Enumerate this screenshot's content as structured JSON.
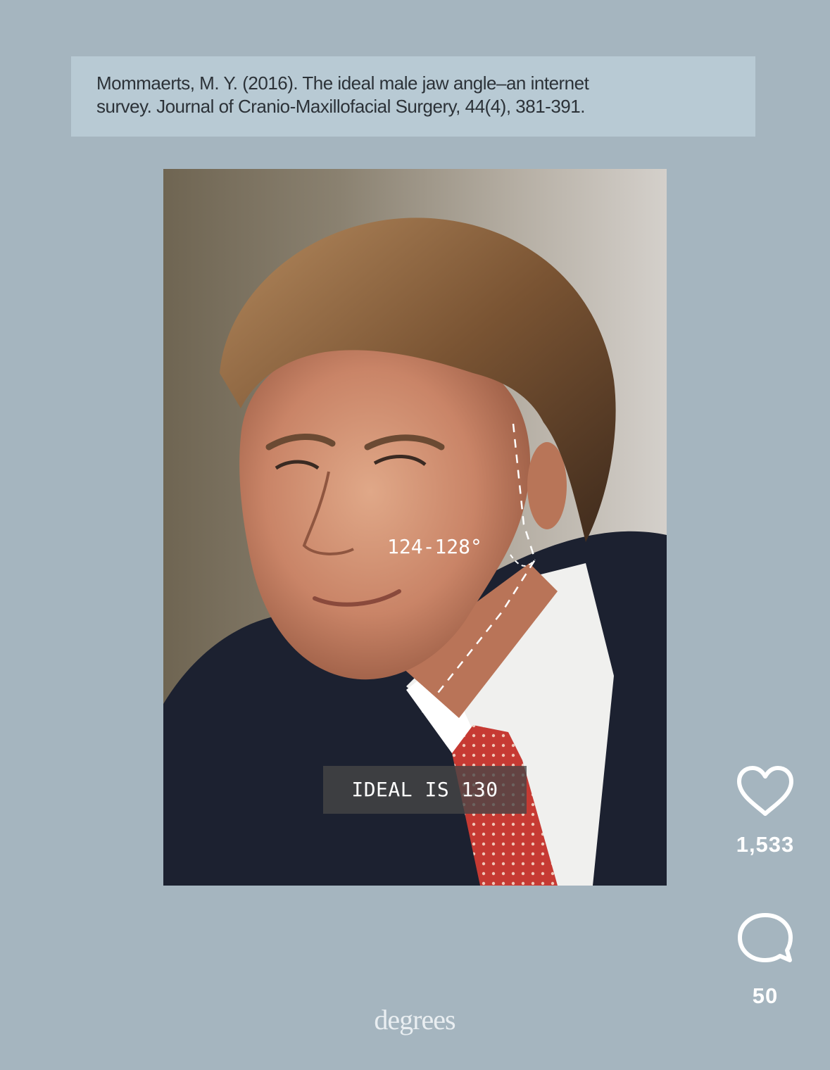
{
  "citation": {
    "line1": "Mommaerts, M. Y. (2016). The ideal male jaw angle–an internet",
    "line2": "survey. Journal of Cranio-Maxillofacial Surgery, 44(4), 381-391."
  },
  "photo": {
    "angle_label": "124-128°",
    "ideal_label": "IDEAL IS 130"
  },
  "actions": {
    "like": {
      "icon": "heart-icon",
      "count": "1,533"
    },
    "comment": {
      "icon": "comment-icon",
      "count": "50"
    }
  },
  "watermark": "degrees",
  "colors": {
    "background": "#a5b5bf",
    "citation_box": "#b8cad4",
    "text_dark": "#2c3238",
    "icon_white": "#ffffff"
  }
}
